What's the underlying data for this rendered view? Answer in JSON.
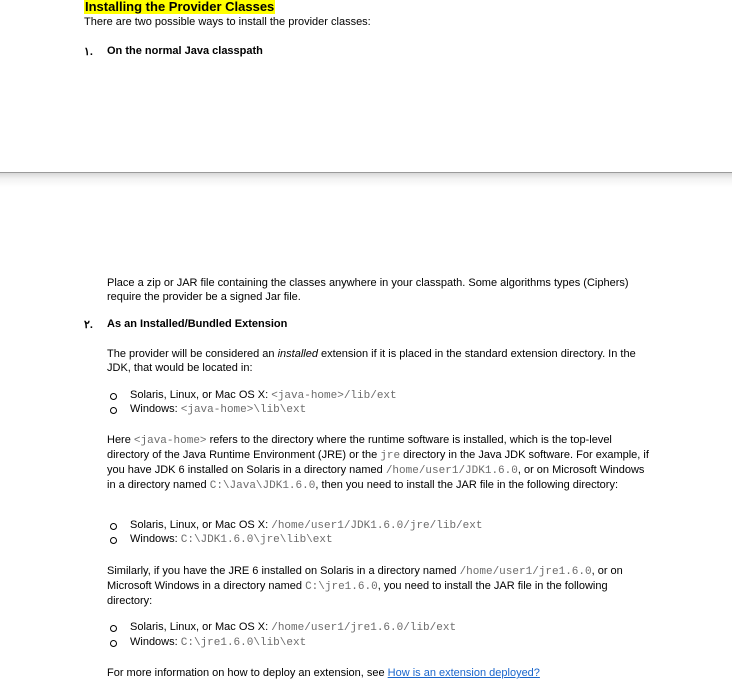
{
  "heading": "Installing the Provider Classes",
  "intro": "There are two possible ways to install the provider classes:",
  "items": [
    {
      "number": "١.",
      "title": "On the normal Java classpath"
    },
    {
      "number": "٢.",
      "title": "As an Installed/Bundled Extension"
    }
  ],
  "classpath_para": "Place a zip or JAR file containing the classes anywhere in your classpath. Some algorithms types (Ciphers) require the provider be a signed Jar file.",
  "installed_para": {
    "pre": "The provider will be considered an ",
    "em": "installed",
    "post": " extension if it is placed in the standard extension directory. In the JDK, that would be located in:"
  },
  "list1": [
    {
      "label": "Solaris, Linux, or Mac OS X: ",
      "code": "<java-home>/lib/ext"
    },
    {
      "label": "Windows: ",
      "code": "<java-home>\\lib\\ext"
    }
  ],
  "here_para": {
    "t1": "Here ",
    "c1": "<java-home>",
    "t2": " refers to the directory where the runtime software is installed, which is the top-level directory of the Java Runtime Environment (JRE) or the ",
    "c2": "jre",
    "t3": " directory in the Java JDK software. For example, if you have JDK 6 installed on Solaris in a directory named ",
    "c3": "/home/user1/JDK1.6.0",
    "t4": ", or on Microsoft Windows in a directory named ",
    "c4": "C:\\Java\\JDK1.6.0",
    "t5": ", then you need to install the JAR file in the following directory:"
  },
  "list2": [
    {
      "label": "Solaris, Linux, or Mac OS X: ",
      "code": "/home/user1/JDK1.6.0/jre/lib/ext"
    },
    {
      "label": "Windows: ",
      "code": "C:\\JDK1.6.0\\jre\\lib\\ext"
    }
  ],
  "similar_para": {
    "t1": "Similarly, if you have the JRE 6 installed on Solaris in a directory named ",
    "c1": "/home/user1/jre1.6.0",
    "t2": ", or on Microsoft Windows in a directory named ",
    "c2": "C:\\jre1.6.0",
    "t3": ", you need to install the JAR file in the following directory:"
  },
  "list3": [
    {
      "label": "Solaris, Linux, or Mac OS X: ",
      "code": "/home/user1/jre1.6.0/lib/ext"
    },
    {
      "label": "Windows: ",
      "code": "C:\\jre1.6.0\\lib\\ext"
    }
  ],
  "more_info": {
    "text": "For more information on how to deploy an extension, see ",
    "link": "How is an extension deployed?"
  }
}
